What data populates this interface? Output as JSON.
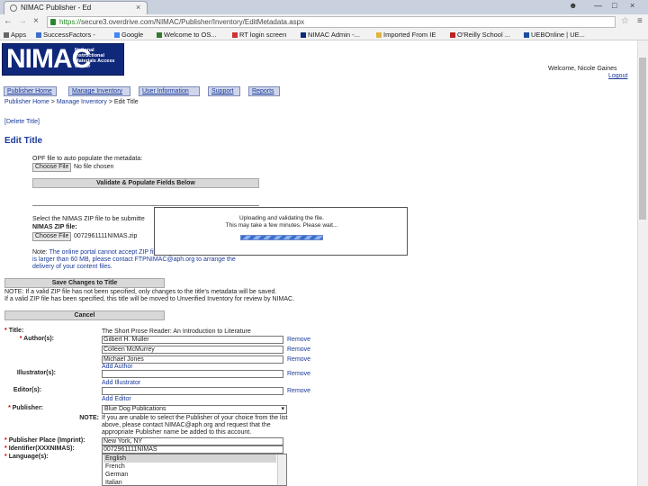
{
  "browser": {
    "tab_title": "NIMAC Publisher - Ed",
    "url_https": "https://",
    "url_rest": "secure3.overdrive.com/NIMAC/Publisher/Inventory/EditMetadata.aspx",
    "bookmarks": [
      "Apps",
      "SuccessFactors -",
      "Google",
      "Welcome to OS...",
      "RT login screen",
      "NIMAC Admin -...",
      "Imported From IE",
      "O'Reilly School ...",
      "UEBOnline | UE..."
    ]
  },
  "header": {
    "logo_word": "NIMAC",
    "logo_sub": "National Instructional Materials Access Center",
    "welcome": "Welcome, Nicole Gaines",
    "logout": "Logout"
  },
  "nav": [
    "Publisher Home",
    "Manage Inventory",
    "User Information",
    "Support",
    "Reports"
  ],
  "breadcrumb": {
    "home": "Publisher Home",
    "sep": ">",
    "inventory": "Manage Inventory",
    "current": "Edit Title"
  },
  "page": {
    "delete_link": "[Delete Title]",
    "heading": "Edit Title",
    "opf_label": "OPF file to auto populate the metadata:",
    "choose_file": "Choose File",
    "no_file": "No file chosen",
    "validate_button": "Validate & Populate Fields Below",
    "zip_label": "Select the NIMAS ZIP file to be submitte",
    "zip_heading": "NIMAS ZIP file:",
    "zip_filename": "0072961111NIMAS.zip",
    "note1_prefix": "Note:",
    "note1_text": "The online portal cannot accept ZIP files larger than 60 MB. If your ZIP file is larger than 60 MB, please contact FTPNIMAC@aph.org to arrange the delivery of your content files.",
    "save_button": "Save Changes to Title",
    "note2_line1": "NOTE: If a valid ZIP file has not been specified, only changes to the title's metadata will be saved.",
    "note2_line2": "If a valid ZIP file has been specified, this title will be moved to Unverified Inventory for review by NIMAC.",
    "cancel_button": "Cancel"
  },
  "modal": {
    "line1": "Uploading and validating the file.",
    "line2": "This may take a few minutes. Please wait..."
  },
  "form": {
    "title_label": "Title:",
    "title_value": "The Short Prose Reader: An Introduction to Literature",
    "authors_label": "Author(s):",
    "authors": [
      "Gilbert H. Muller",
      "Colleen McMurrey",
      "Michael Jones"
    ],
    "remove": "Remove",
    "add_author": "Add Author",
    "illustrators_label": "Illustrator(s):",
    "add_illustrator": "Add Illustrator",
    "editors_label": "Editor(s):",
    "add_editor": "Add Editor",
    "publisher_label": "Publisher:",
    "publisher_value": "Blue Dog Publications",
    "publisher_note_label": "NOTE:",
    "publisher_note": "If you are unable to select the Publisher of your choice from the list above, please contact NIMAC@aph.org and request that the appropriate Publisher name be added to this account.",
    "place_label": "Publisher Place (Imprint):",
    "place_value": "New York, NY",
    "identifier_label": "Identifier(XXXNIMAS):",
    "identifier_value": "0072961111NIMAS",
    "language_label": "Language(s):",
    "languages": [
      "English",
      "French",
      "German",
      "Italian"
    ]
  }
}
